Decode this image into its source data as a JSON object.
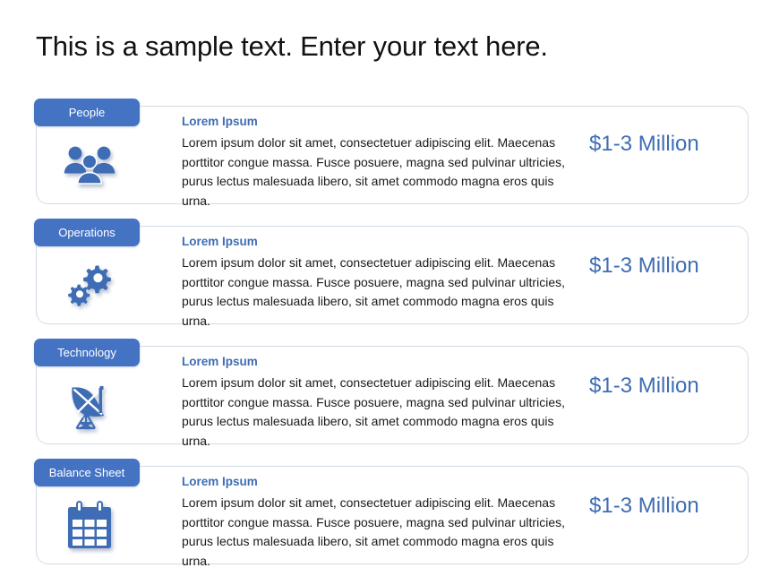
{
  "slide": {
    "title": "This is a sample text. Enter your text here.",
    "background_color": "#ffffff",
    "accent_color": "#4573C4",
    "text_color": "#1a1a1a",
    "card_border_color": "#d2dbe6"
  },
  "rows": [
    {
      "badge_label": "People",
      "icon": "people-icon",
      "heading": "Lorem Ipsum",
      "body": "Lorem ipsum dolor sit amet, consectetuer adipiscing elit. Maecenas porttitor congue massa. Fusce posuere, magna sed pulvinar ultricies, purus lectus malesuada libero, sit amet commodo magna eros quis urna.",
      "price": "$1-3 Million"
    },
    {
      "badge_label": "Operations",
      "icon": "gears-icon",
      "heading": "Lorem Ipsum",
      "body": "Lorem ipsum dolor sit amet, consectetuer adipiscing elit. Maecenas porttitor congue massa. Fusce posuere, magna sed pulvinar ultricies, purus lectus malesuada libero, sit amet commodo magna eros quis urna.",
      "price": "$1-3 Million"
    },
    {
      "badge_label": "Technology",
      "icon": "satellite-dish-icon",
      "heading": "Lorem Ipsum",
      "body": "Lorem ipsum dolor sit amet, consectetuer adipiscing elit. Maecenas porttitor congue massa. Fusce posuere, magna sed pulvinar ultricies, purus lectus malesuada libero, sit amet commodo magna eros quis urna.",
      "price": "$1-3 Million"
    },
    {
      "badge_label": "Balance Sheet",
      "icon": "calendar-icon",
      "heading": "Lorem Ipsum",
      "body": "Lorem ipsum dolor sit amet, consectetuer adipiscing elit. Maecenas porttitor congue massa. Fusce posuere, magna sed pulvinar ultricies, purus lectus malesuada libero, sit amet commodo magna eros quis urna.",
      "price": "$1-3 Million"
    }
  ]
}
